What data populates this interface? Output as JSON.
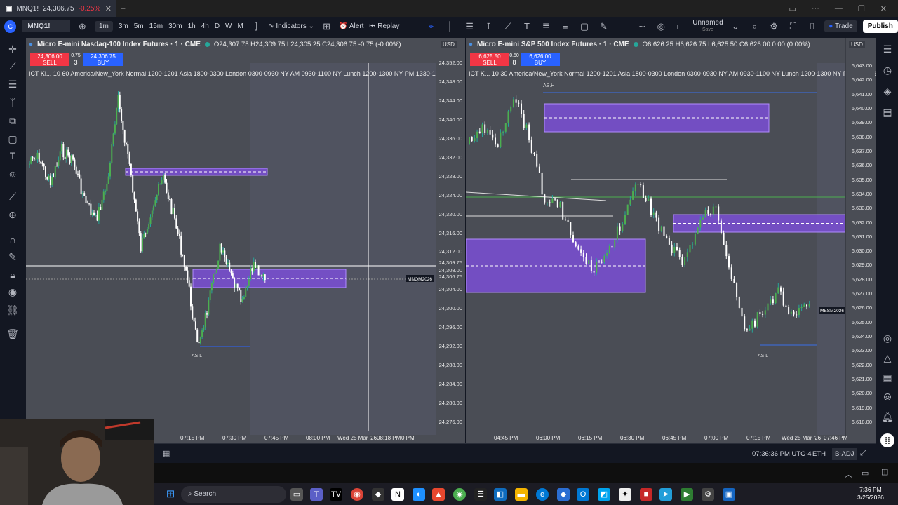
{
  "tab": {
    "title": "MNQ1!",
    "price": "24,306.75",
    "change": "-0.25%"
  },
  "toolbar": {
    "symbol": "MNQ1!",
    "tf_1m": "1m",
    "tf_3m": "3m",
    "tf_5m": "5m",
    "tf_15m": "15m",
    "tf_30m": "30m",
    "tf_1h": "1h",
    "tf_4h": "4h",
    "tf_d": "D",
    "tf_w": "W",
    "tf_m": "M",
    "indicators": "Indicators",
    "alert": "Alert",
    "replay": "Replay",
    "layout_name": "Unnamed",
    "layout_sub": "Save",
    "trade": "Trade",
    "publish": "Publish"
  },
  "left": {
    "title": "Micro E-mini Nasdaq-100 Index Futures · 1 · CME",
    "ohlc": "O24,307.75 H24,309.75 L24,305.25 C24,306.75 -0.75 (-0.00%)",
    "sell_price": "24,306.00",
    "sell": "SELL",
    "spread": "0.75",
    "qty": "3",
    "buy_price": "24,306.75",
    "buy": "BUY",
    "ind": "ICT Ki... 10 60 America/New_York Normal 1200-1201 Asia 1800-0300 London 0300-0930 NY AM 0930-1100 NY Lunch 1200-1300 NY PM 1330-1600 70 4I",
    "currency": "USD",
    "prices": [
      "24,352.00",
      "24,348.00",
      "24,344.00",
      "24,340.00",
      "24,336.00",
      "24,332.00",
      "24,328.00",
      "24,324.00",
      "24,320.00",
      "24,316.00",
      "24,312.00",
      "24,309.75",
      "24,308.00",
      "24,306.75",
      "24,304.00",
      "24,300.00",
      "24,296.00",
      "24,292.00",
      "24,288.00",
      "24,284.00",
      "24,280.00",
      "24,276.00"
    ],
    "contract": "MNQM2026",
    "countdown": "00:25",
    "cur_price": "24,306.75",
    "lbl_asl": "AS.L",
    "times": [
      "07:15 PM",
      "07:30 PM",
      "07:45 PM",
      "08:00 PM",
      "Wed 25 Mar '26",
      "08:18 PM",
      "0 PM"
    ]
  },
  "right": {
    "title": "Micro E-mini S&P 500 Index Futures · 1 · CME",
    "ohlc": "O6,626.25 H6,626.75 L6,625.50 C6,626.00 0.00 (0.00%)",
    "sell_price": "6,625.50",
    "sell": "SELL",
    "spread": "0.50",
    "qty": "8",
    "buy_price": "6,626.00",
    "buy": "BUY",
    "ind": "ICT K... 10 30 America/New_York Normal 1200-1201 Asia 1800-0300 London 0300-0930 NY AM 0930-1100 NY Lunch 1200-1300 NY PM 1330-1600 70",
    "currency": "USD",
    "prices": [
      "6,643.00",
      "6,642.00",
      "6,641.00",
      "6,640.00",
      "6,639.00",
      "6,638.00",
      "6,637.00",
      "6,636.00",
      "6,635.00",
      "6,634.00",
      "6,633.00",
      "6,632.00",
      "6,631.00",
      "6,630.00",
      "6,629.00",
      "6,628.00",
      "6,627.00",
      "6,626.00",
      "6,625.00",
      "6,624.00",
      "6,623.00",
      "6,622.00",
      "6,621.00",
      "6,620.00",
      "6,619.00",
      "6,618.00"
    ],
    "green_tag": "6,634.00",
    "contract": "MESM2026",
    "countdown": "00:25",
    "cur_price": "6,626.00",
    "lbl_ash": "AS.H",
    "lbl_asl": "AS.L",
    "times": [
      "04:45 PM",
      "06:00 PM",
      "06:15 PM",
      "06:30 PM",
      "06:45 PM",
      "07:00 PM",
      "07:15 PM",
      "Wed 25 Mar '26",
      "07:46 PM"
    ]
  },
  "status": {
    "clock": "07:36:36 PM UTC-4",
    "session": "ETH",
    "adj": "B-ADJ"
  },
  "taskbar": {
    "search": "Search",
    "time": "7:36 PM",
    "date": "3/25/2026"
  },
  "colors": {
    "fvg": "#7a4fd6",
    "up": "#26a69a",
    "green": "#4caf50",
    "sell": "#f23645",
    "buy": "#2962ff"
  }
}
